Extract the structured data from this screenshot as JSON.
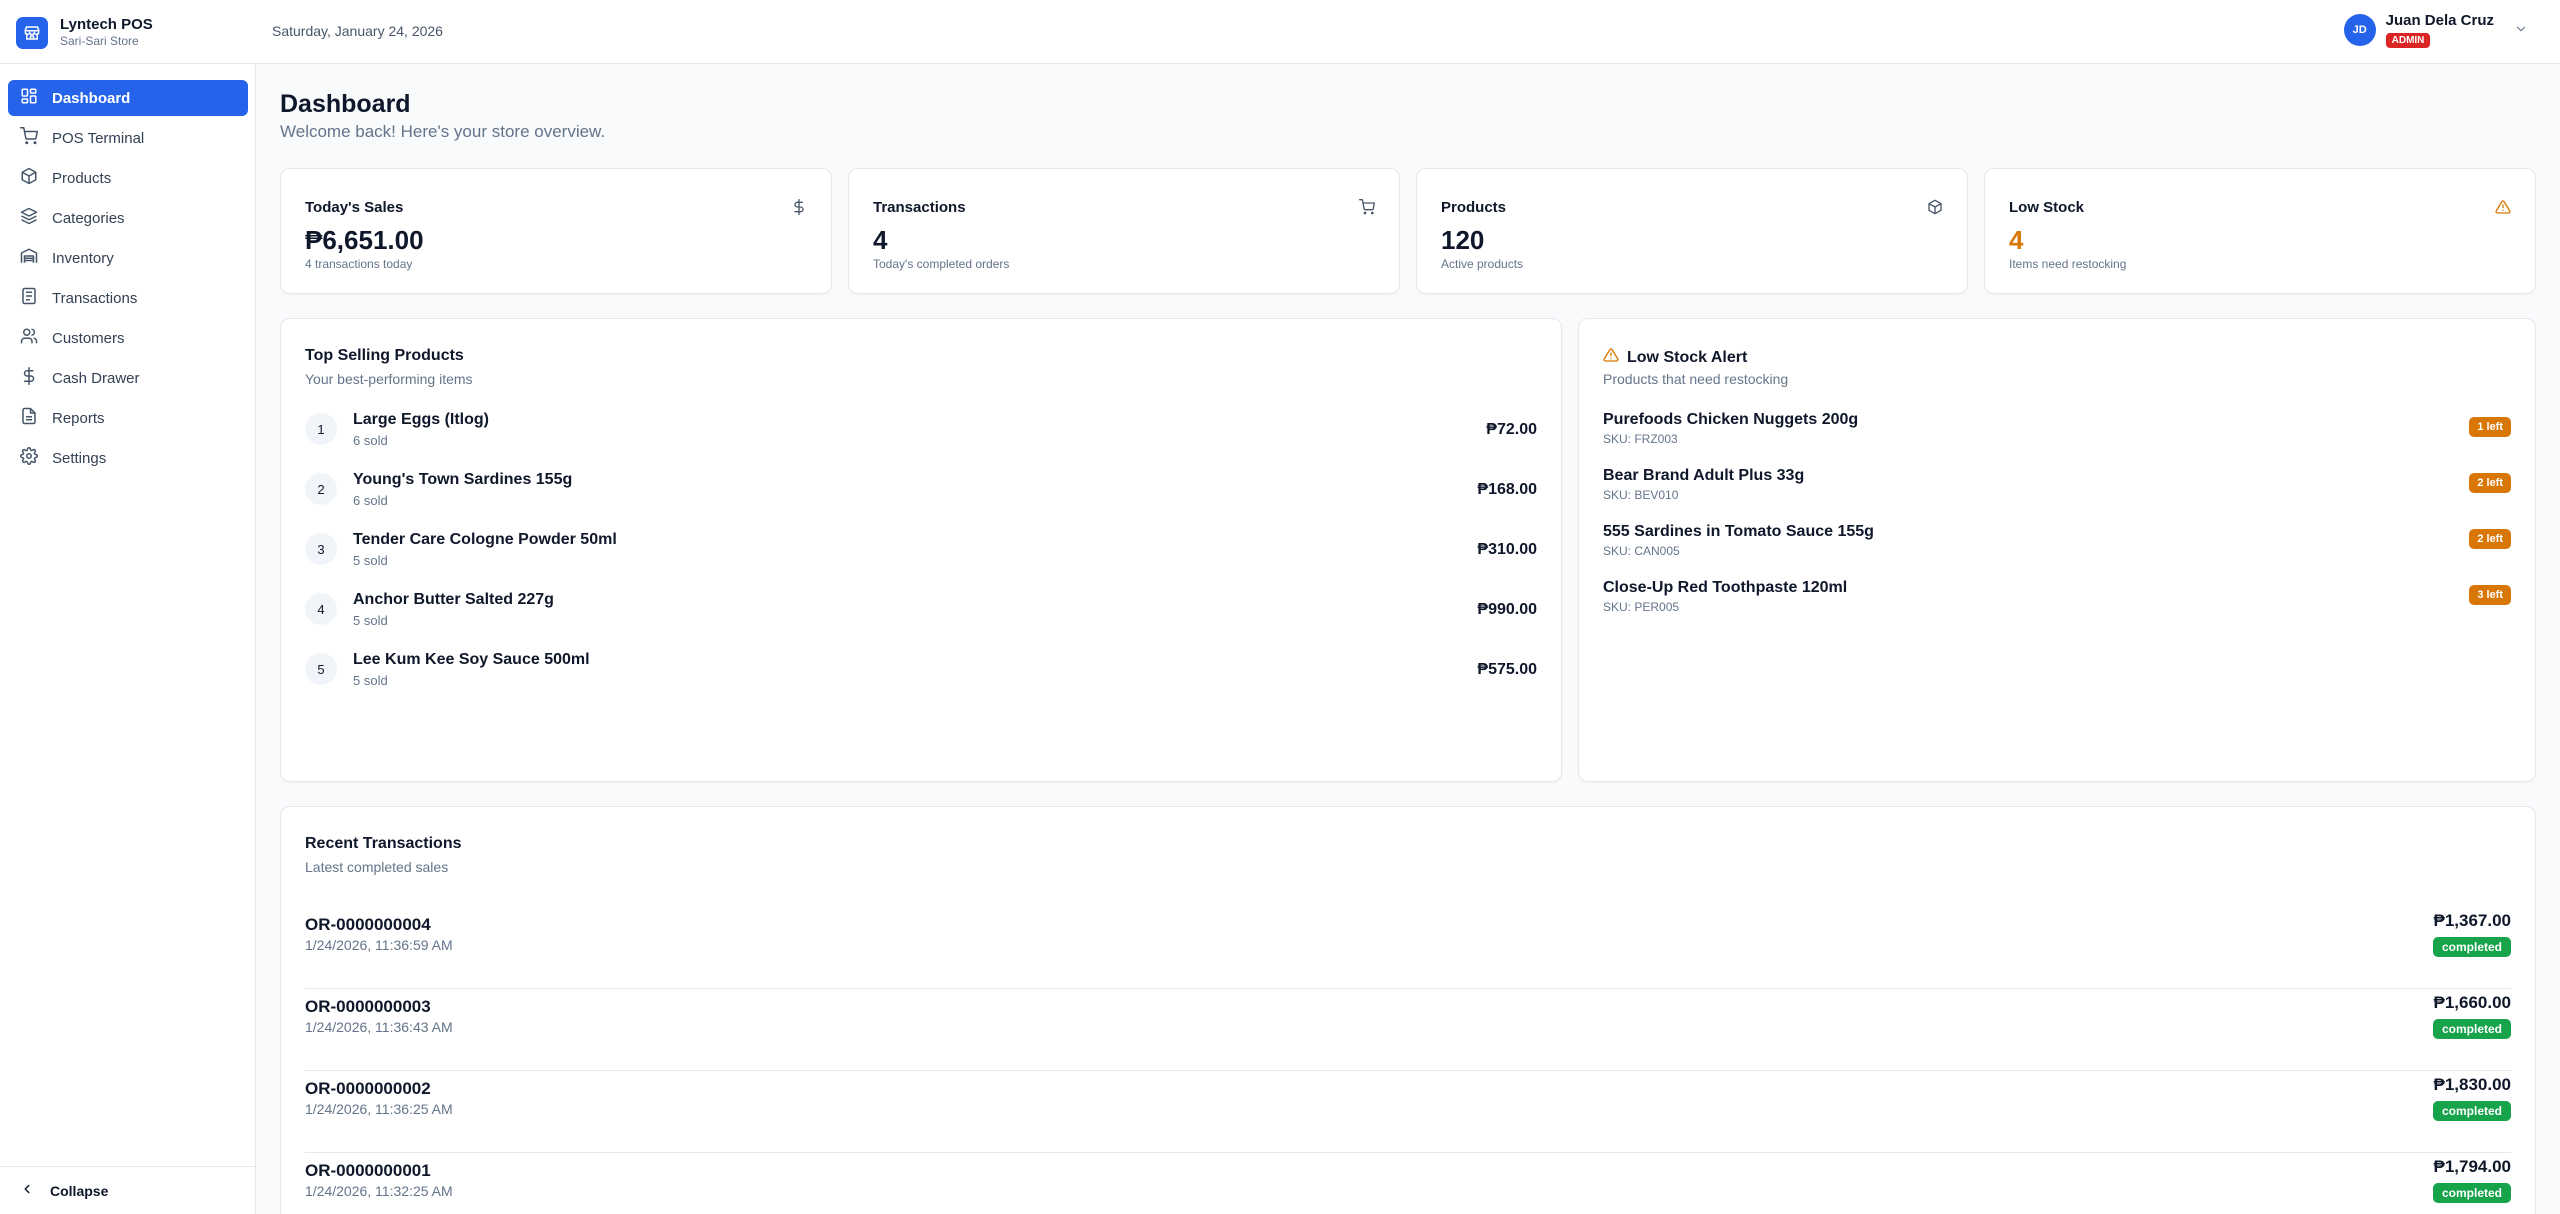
{
  "app": {
    "name": "Lyntech POS",
    "store": "Sari-Sari Store"
  },
  "header": {
    "date": "Saturday, January 24, 2026"
  },
  "user": {
    "initials": "JD",
    "name": "Juan Dela Cruz",
    "role": "ADMIN"
  },
  "sidebar": {
    "items": [
      {
        "label": "Dashboard",
        "icon": "dashboard-icon",
        "active": true
      },
      {
        "label": "POS Terminal",
        "icon": "cart-icon"
      },
      {
        "label": "Products",
        "icon": "package-icon"
      },
      {
        "label": "Categories",
        "icon": "layers-icon"
      },
      {
        "label": "Inventory",
        "icon": "warehouse-icon"
      },
      {
        "label": "Transactions",
        "icon": "receipt-icon"
      },
      {
        "label": "Customers",
        "icon": "users-icon"
      },
      {
        "label": "Cash Drawer",
        "icon": "dollar-icon"
      },
      {
        "label": "Reports",
        "icon": "file-icon"
      },
      {
        "label": "Settings",
        "icon": "gear-icon"
      }
    ],
    "collapse_label": "Collapse"
  },
  "page": {
    "title": "Dashboard",
    "subtitle": "Welcome back! Here's your store overview."
  },
  "stats": [
    {
      "label": "Today's Sales",
      "value": "₱6,651.00",
      "hint": "4 transactions today",
      "icon": "dollar-icon"
    },
    {
      "label": "Transactions",
      "value": "4",
      "hint": "Today's completed orders",
      "icon": "cart-icon"
    },
    {
      "label": "Products",
      "value": "120",
      "hint": "Active products",
      "icon": "package-icon"
    },
    {
      "label": "Low Stock",
      "value": "4",
      "hint": "Items need restocking",
      "icon": "alert-icon",
      "color": "#d97706"
    }
  ],
  "top_selling": {
    "title": "Top Selling Products",
    "subtitle": "Your best-performing items",
    "items": [
      {
        "rank": "1",
        "name": "Large Eggs (Itlog)",
        "sold": "6 sold",
        "amount": "₱72.00"
      },
      {
        "rank": "2",
        "name": "Young's Town Sardines 155g",
        "sold": "6 sold",
        "amount": "₱168.00"
      },
      {
        "rank": "3",
        "name": "Tender Care Cologne Powder 50ml",
        "sold": "5 sold",
        "amount": "₱310.00"
      },
      {
        "rank": "4",
        "name": "Anchor Butter Salted 227g",
        "sold": "5 sold",
        "amount": "₱990.00"
      },
      {
        "rank": "5",
        "name": "Lee Kum Kee Soy Sauce 500ml",
        "sold": "5 sold",
        "amount": "₱575.00"
      }
    ]
  },
  "low_stock": {
    "title": "Low Stock Alert",
    "subtitle": "Products that need restocking",
    "items": [
      {
        "name": "Purefoods Chicken Nuggets 200g",
        "sku": "SKU: FRZ003",
        "badge": "1 left"
      },
      {
        "name": "Bear Brand Adult Plus 33g",
        "sku": "SKU: BEV010",
        "badge": "2 left"
      },
      {
        "name": "555 Sardines in Tomato Sauce 155g",
        "sku": "SKU: CAN005",
        "badge": "2 left"
      },
      {
        "name": "Close-Up Red Toothpaste 120ml",
        "sku": "SKU: PER005",
        "badge": "3 left"
      }
    ]
  },
  "recent": {
    "title": "Recent Transactions",
    "subtitle": "Latest completed sales",
    "items": [
      {
        "id": "OR-0000000004",
        "time": "1/24/2026, 11:36:59 AM",
        "amount": "₱1,367.00",
        "status": "completed"
      },
      {
        "id": "OR-0000000003",
        "time": "1/24/2026, 11:36:43 AM",
        "amount": "₱1,660.00",
        "status": "completed"
      },
      {
        "id": "OR-0000000002",
        "time": "1/24/2026, 11:36:25 AM",
        "amount": "₱1,830.00",
        "status": "completed"
      },
      {
        "id": "OR-0000000001",
        "time": "1/24/2026, 11:32:25 AM",
        "amount": "₱1,794.00",
        "status": "completed"
      }
    ]
  },
  "colors": {
    "primary": "#2563eb",
    "warning": "#d97706",
    "success": "#16a34a",
    "danger": "#dc2626"
  }
}
